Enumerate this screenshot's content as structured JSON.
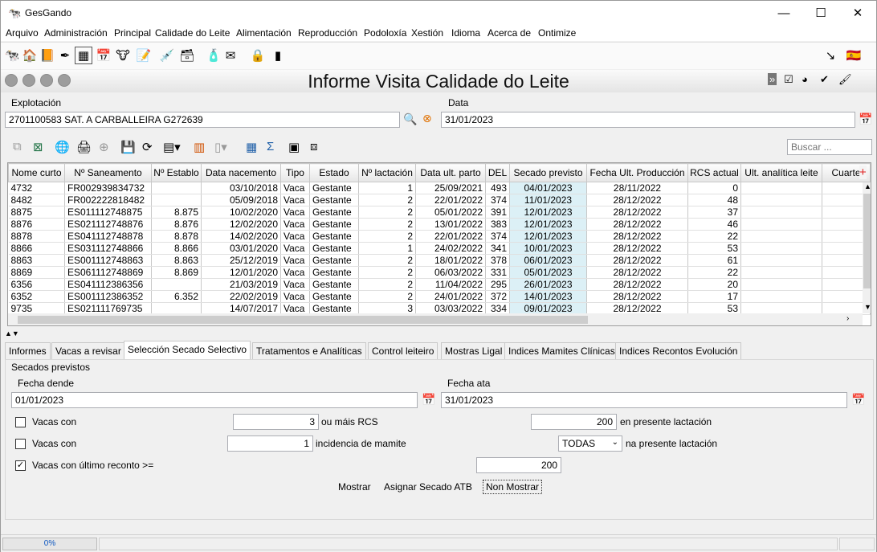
{
  "window": {
    "title": "GesGando",
    "minimize": "—",
    "maximize": "☐",
    "close": "✕"
  },
  "menu": [
    "Arquivo",
    "Administración",
    "Principal",
    "Calidade do Leite",
    "Alimentación",
    "Reproducción",
    "Podoloxía",
    "Xestión",
    "Idioma",
    "Acerca de",
    "Ontimize"
  ],
  "form": {
    "title": "Informe Visita Calidade do Leite"
  },
  "explotacion": {
    "label": "Explotación",
    "value": "2701100583 SAT. A CARBALLEIRA G272639"
  },
  "data": {
    "label": "Data",
    "value": "31/01/2023"
  },
  "search": {
    "placeholder": "Buscar ..."
  },
  "grid": {
    "columns": [
      "Nome curto",
      "Nº Saneamento",
      "Nº Establo",
      "Data nacemento",
      "Tipo",
      "Estado",
      "Nº lactación",
      "Data ult. parto",
      "DEL",
      "Secado previsto",
      "Fecha Ult. Producción",
      "RCS actual",
      "Ult. analítica leite",
      "Cuarte"
    ],
    "rows": [
      [
        "4732",
        "FR002939834732",
        "",
        "03/10/2018",
        "Vaca",
        "Gestante",
        "1",
        "25/09/2021",
        "493",
        "04/01/2023",
        "28/11/2022",
        "0",
        ""
      ],
      [
        "8482",
        "FR002222818482",
        "",
        "05/09/2018",
        "Vaca",
        "Gestante",
        "2",
        "22/01/2022",
        "374",
        "11/01/2023",
        "28/12/2022",
        "48",
        ""
      ],
      [
        "8875",
        "ES011112748875",
        "8.875",
        "10/02/2020",
        "Vaca",
        "Gestante",
        "2",
        "05/01/2022",
        "391",
        "12/01/2023",
        "28/12/2022",
        "37",
        ""
      ],
      [
        "8876",
        "ES021112748876",
        "8.876",
        "12/02/2020",
        "Vaca",
        "Gestante",
        "2",
        "13/01/2022",
        "383",
        "12/01/2023",
        "28/12/2022",
        "46",
        ""
      ],
      [
        "8878",
        "ES041112748878",
        "8.878",
        "14/02/2020",
        "Vaca",
        "Gestante",
        "2",
        "22/01/2022",
        "374",
        "12/01/2023",
        "28/12/2022",
        "22",
        ""
      ],
      [
        "8866",
        "ES031112748866",
        "8.866",
        "03/01/2020",
        "Vaca",
        "Gestante",
        "1",
        "24/02/2022",
        "341",
        "10/01/2023",
        "28/12/2022",
        "53",
        ""
      ],
      [
        "8863",
        "ES001112748863",
        "8.863",
        "25/12/2019",
        "Vaca",
        "Gestante",
        "2",
        "18/01/2022",
        "378",
        "06/01/2023",
        "28/12/2022",
        "61",
        ""
      ],
      [
        "8869",
        "ES061112748869",
        "8.869",
        "12/01/2020",
        "Vaca",
        "Gestante",
        "2",
        "06/03/2022",
        "331",
        "05/01/2023",
        "28/12/2022",
        "22",
        ""
      ],
      [
        "6356",
        "ES041112386356",
        "",
        "21/03/2019",
        "Vaca",
        "Gestante",
        "2",
        "11/04/2022",
        "295",
        "26/01/2023",
        "28/12/2022",
        "20",
        ""
      ],
      [
        "6352",
        "ES001112386352",
        "6.352",
        "22/02/2019",
        "Vaca",
        "Gestante",
        "2",
        "24/01/2022",
        "372",
        "14/01/2023",
        "28/12/2022",
        "17",
        ""
      ],
      [
        "9735",
        "ES021111769735",
        "",
        "14/07/2017",
        "Vaca",
        "Gestante",
        "3",
        "03/03/2022",
        "334",
        "09/01/2023",
        "28/12/2022",
        "53",
        ""
      ]
    ]
  },
  "tabs": [
    "Informes",
    "Vacas a revisar",
    "Selección Secado Selectivo",
    "Tratamentos e Analíticas",
    "Control leiteiro",
    "Mostras Ligal",
    "Indices Mamites Clínicas",
    "Indices Recontos Evolución"
  ],
  "panel": {
    "group_title": "Secados previstos",
    "fecha_dende": {
      "label": "Fecha dende",
      "value": "01/01/2023"
    },
    "fecha_ata": {
      "label": "Fecha ata",
      "value": "31/01/2023"
    },
    "row1": {
      "checkbox_label": "Vacas con",
      "value": "3",
      "mid_label": "ou máis RCS",
      "value2": "200",
      "end_label": "en presente lactación",
      "checked": false
    },
    "row2": {
      "checkbox_label": "Vacas con",
      "value": "1",
      "mid_label": "incidencia de mamite",
      "select": "TODAS",
      "end_label": "na presente lactación",
      "checked": false
    },
    "row3": {
      "checkbox_label": "Vacas con último reconto >=",
      "value": "200",
      "checked": true
    },
    "buttons": {
      "mostrar": "Mostrar",
      "asignar": "Asignar Secado ATB",
      "non_mostrar": "Non Mostrar"
    }
  },
  "status": {
    "progress": "0%"
  },
  "icons": [
    "app-cow-icon",
    "search-icon",
    "clear-icon",
    "calendar-icon",
    "lock-icon",
    "spain-flag-icon",
    "excel-icon",
    "print-icon",
    "save-icon",
    "add-column-icon"
  ]
}
